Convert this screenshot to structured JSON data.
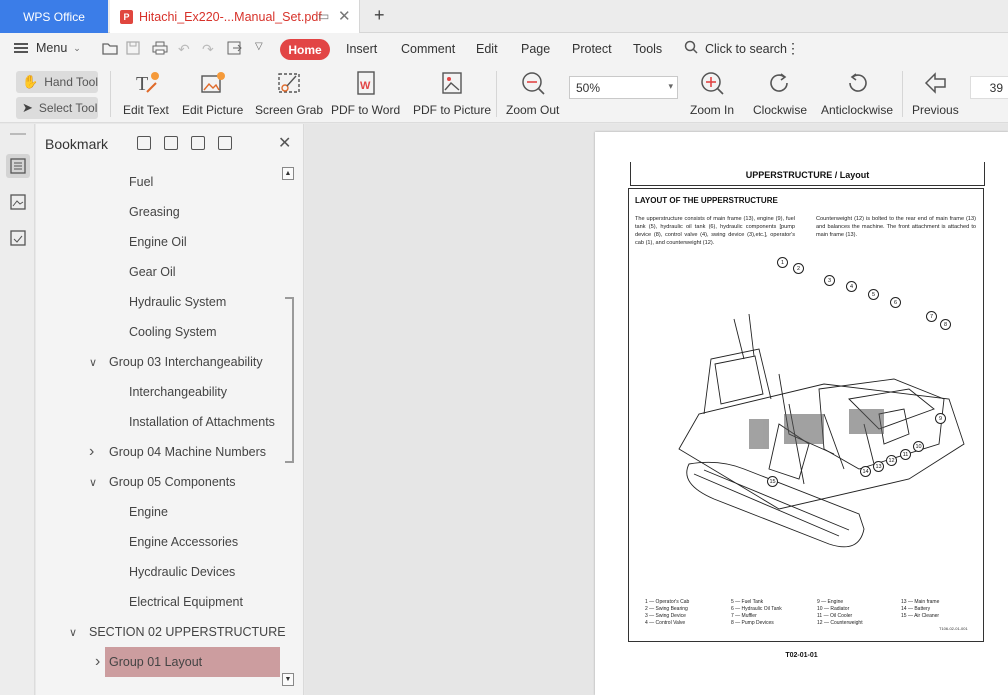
{
  "titlebar": {
    "app_tab": "WPS Office",
    "doc_tab": "Hitachi_Ex220-...Manual_Set.pdf"
  },
  "menubar": {
    "menu_label": "Menu",
    "home": "Home",
    "items": [
      "Insert",
      "Comment",
      "Edit",
      "Page",
      "Protect",
      "Tools"
    ],
    "search": "Click to search"
  },
  "ribbon": {
    "hand_tool": "Hand Tool",
    "select_tool": "Select Tool",
    "buttons": [
      "Edit Text",
      "Edit Picture",
      "Screen Grab",
      "PDF to Word",
      "PDF to Picture",
      "Zoom Out",
      "Zoom In",
      "Clockwise",
      "Anticlockwise",
      "Previous"
    ],
    "zoom_value": "50%",
    "page_number": "39"
  },
  "bookmark": {
    "title": "Bookmark",
    "items": [
      {
        "label": "Fuel",
        "level": 2,
        "chevron": ""
      },
      {
        "label": "Greasing",
        "level": 2,
        "chevron": ""
      },
      {
        "label": "Engine Oil",
        "level": 2,
        "chevron": ""
      },
      {
        "label": "Gear Oil",
        "level": 2,
        "chevron": ""
      },
      {
        "label": "Hydraulic System",
        "level": 2,
        "chevron": ""
      },
      {
        "label": "Cooling System",
        "level": 2,
        "chevron": ""
      },
      {
        "label": "Group 03 Interchangeability",
        "level": 1,
        "chevron": "down"
      },
      {
        "label": "Interchangeability",
        "level": 2,
        "chevron": ""
      },
      {
        "label": "Installation of Attachments",
        "level": 2,
        "chevron": ""
      },
      {
        "label": "Group 04 Machine Numbers",
        "level": 1,
        "chevron": "right"
      },
      {
        "label": "Group 05 Components",
        "level": 1,
        "chevron": "down"
      },
      {
        "label": "Engine",
        "level": 2,
        "chevron": ""
      },
      {
        "label": "Engine Accessories",
        "level": 2,
        "chevron": ""
      },
      {
        "label": "Hycdraulic Devices",
        "level": 2,
        "chevron": ""
      },
      {
        "label": "Electrical Equipment",
        "level": 2,
        "chevron": ""
      },
      {
        "label": "SECTION 02 UPPERSTRUCTURE",
        "level": 0,
        "chevron": "down"
      },
      {
        "label": "Group 01 Layout",
        "level": 1,
        "chevron": "right",
        "selected": true
      }
    ]
  },
  "document": {
    "header": "UPPERSTRUCTURE / Layout",
    "section_title": "LAYOUT OF THE UPPERSTRUCTURE",
    "para_left": "The upperstructure consists of main frame (13), engine (9), fuel tank (5), hydraulic oil tank (6), hydraulic components [pump device (8), control valve (4), swing device (3),etc.], operator's cab (1), and counterweight (12).",
    "para_right": "Counterweight (12) is bolted to the rear end of main frame (13) and balances the machine. The front attachment is attached to main frame (13).",
    "figure_code": "T106-02-01-001",
    "callouts": [
      "1",
      "2",
      "3",
      "4",
      "5",
      "6",
      "7",
      "8",
      "9",
      "10",
      "11",
      "12",
      "13",
      "14",
      "15"
    ],
    "legend": [
      [
        "1 — Operator's Cab",
        "2 — Swing Bearing",
        "3 — Swing Device",
        "4 — Control Valve"
      ],
      [
        "5 — Fuel Tank",
        "6 — Hydraulic Oil Tank",
        "7 — Muffler",
        "8 — Pump Devices"
      ],
      [
        "9 — Engine",
        "10 — Radiator",
        "11 — Oil Cooler",
        "12 — Counterweight"
      ],
      [
        "13 — Main frame",
        "14 — Battery",
        "15 — Air Cleaner"
      ]
    ],
    "footer": "T02-01-01"
  }
}
